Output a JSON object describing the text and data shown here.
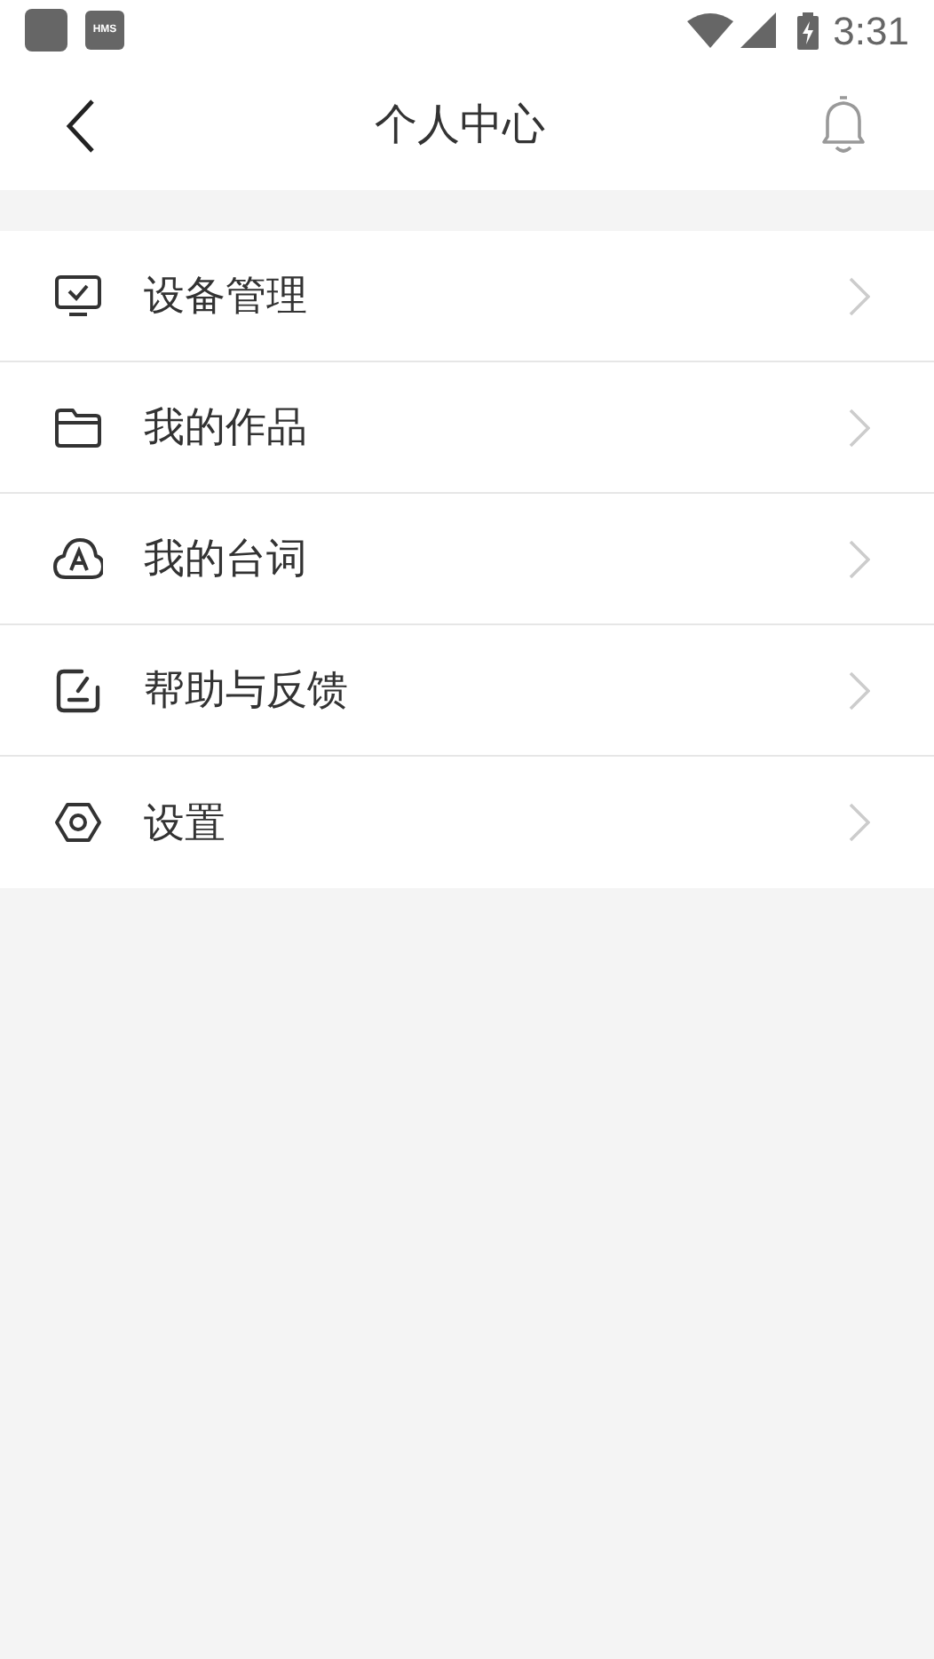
{
  "status_bar": {
    "app_badge": "HMS",
    "time": "3:31"
  },
  "header": {
    "title": "个人中心"
  },
  "menu": {
    "items": [
      {
        "label": "设备管理"
      },
      {
        "label": "我的作品"
      },
      {
        "label": "我的台词"
      },
      {
        "label": "帮助与反馈"
      },
      {
        "label": "设置"
      }
    ]
  }
}
